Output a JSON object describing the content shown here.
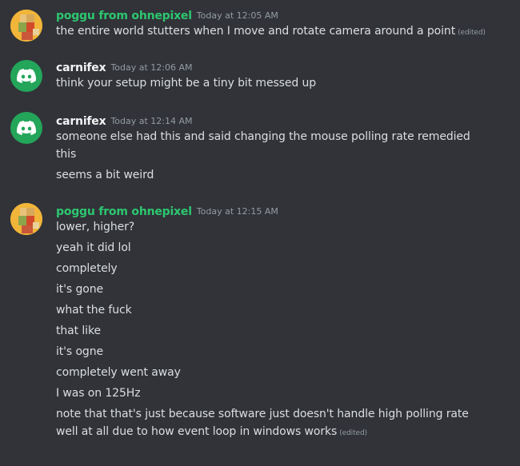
{
  "colors": {
    "background": "#313338",
    "username_green": "#2dc770",
    "username_white": "#f2f3f5",
    "message_text": "#dbdee1",
    "timestamp": "#949ba4",
    "discord_avatar_bg": "#23a55a"
  },
  "messages": [
    {
      "avatar": "pixelated-avatar",
      "author": "poggu from ohnepixel",
      "timestamp": "Today at 12:05 AM",
      "lines": [
        {
          "text": "the entire world stutters when I move and rotate camera around a point",
          "edited": "(edited)"
        }
      ]
    },
    {
      "avatar": "discord-logo-icon",
      "author": "carnifex",
      "timestamp": "Today at 12:06 AM",
      "lines": [
        {
          "text": "think your setup might be a tiny bit messed up"
        }
      ]
    },
    {
      "avatar": "discord-logo-icon",
      "author": "carnifex",
      "timestamp": "Today at 12:14 AM",
      "lines": [
        {
          "text": "someone else had this and said changing the mouse polling rate remedied"
        },
        {
          "text": "this"
        },
        {
          "text": "seems a bit weird"
        }
      ]
    },
    {
      "avatar": "pixelated-avatar",
      "author": "poggu from ohnepixel",
      "timestamp": "Today at 12:15 AM",
      "lines": [
        {
          "text": "lower, higher?"
        },
        {
          "text": "yeah it did lol"
        },
        {
          "text": "completely"
        },
        {
          "text": "it's gone"
        },
        {
          "text": "what the fuck"
        },
        {
          "text": "that like"
        },
        {
          "text": "it's ogne"
        },
        {
          "text": "completely went away"
        },
        {
          "text": "I was on 125Hz"
        },
        {
          "text": "note that that's just because software just doesn't handle high polling rate"
        },
        {
          "text": "well at all due to how event loop in windows works",
          "edited": "(edited)"
        }
      ]
    }
  ]
}
